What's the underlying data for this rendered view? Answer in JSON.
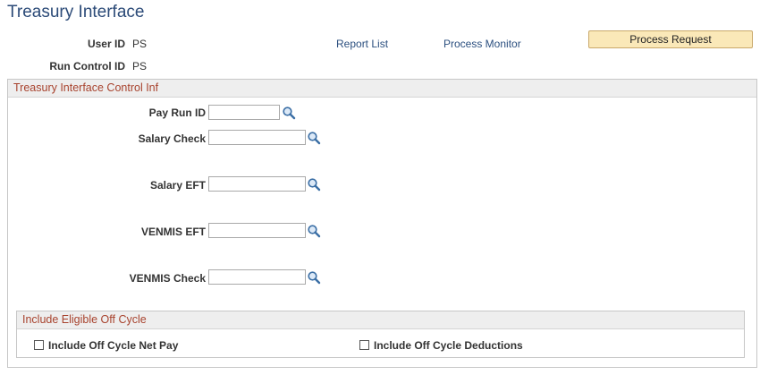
{
  "page": {
    "title": "Treasury Interface"
  },
  "header": {
    "user_id_label": "User ID",
    "user_id_value": "PS",
    "run_control_label": "Run Control ID",
    "run_control_value": "PS",
    "report_list_link": "Report List",
    "process_monitor_link": "Process Monitor",
    "process_request_button": "Process Request"
  },
  "control_group": {
    "title": "Treasury Interface Control Inf",
    "fields": [
      {
        "label": "Pay Run ID",
        "value": ""
      },
      {
        "label": "Salary Check",
        "value": ""
      },
      {
        "label": "Salary EFT",
        "value": ""
      },
      {
        "label": "VENMIS EFT",
        "value": ""
      },
      {
        "label": "VENMIS Check",
        "value": ""
      }
    ]
  },
  "off_cycle_group": {
    "title": "Include Eligible Off Cycle",
    "net_pay_label": "Include Off Cycle Net Pay",
    "net_pay_checked": false,
    "deductions_label": "Include Off Cycle Deductions",
    "deductions_checked": false
  },
  "icons": {
    "lookup": "magnifier-lookup-icon",
    "checkbox": "checkbox-icon"
  },
  "colors": {
    "title": "#2c4b78",
    "group_title": "#a8432e",
    "button_bg": "#fae8b8",
    "link": "#2b4f7f"
  }
}
